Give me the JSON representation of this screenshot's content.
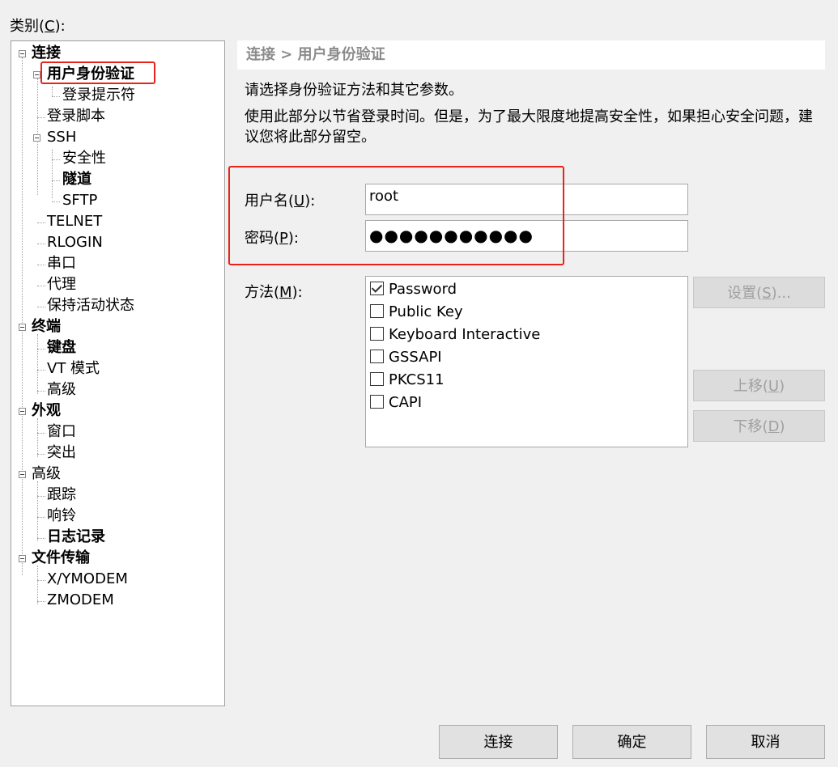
{
  "category": {
    "label": "类别",
    "hotkey": "C"
  },
  "tree": [
    {
      "label": "连接",
      "bold": true
    },
    {
      "label": "用户身份验证",
      "bold": true
    },
    {
      "label": "登录提示符",
      "bold": false
    },
    {
      "label": "登录脚本",
      "bold": false
    },
    {
      "label": "SSH",
      "bold": false
    },
    {
      "label": "安全性",
      "bold": false
    },
    {
      "label": "隧道",
      "bold": true
    },
    {
      "label": "SFTP",
      "bold": false
    },
    {
      "label": "TELNET",
      "bold": false
    },
    {
      "label": "RLOGIN",
      "bold": false
    },
    {
      "label": "串口",
      "bold": false
    },
    {
      "label": "代理",
      "bold": false
    },
    {
      "label": "保持活动状态",
      "bold": false
    },
    {
      "label": "终端",
      "bold": true
    },
    {
      "label": "键盘",
      "bold": true
    },
    {
      "label": "VT 模式",
      "bold": false
    },
    {
      "label": "高级",
      "bold": false
    },
    {
      "label": "外观",
      "bold": true
    },
    {
      "label": "窗口",
      "bold": false
    },
    {
      "label": "突出",
      "bold": false
    },
    {
      "label": "高级",
      "bold": false
    },
    {
      "label": "跟踪",
      "bold": false
    },
    {
      "label": "响铃",
      "bold": false
    },
    {
      "label": "日志记录",
      "bold": true
    },
    {
      "label": "文件传输",
      "bold": true
    },
    {
      "label": "X/YMODEM",
      "bold": false
    },
    {
      "label": "ZMODEM",
      "bold": false
    }
  ],
  "breadcrumb": "连接 > 用户身份验证",
  "description1": "请选择身份验证方法和其它参数。",
  "description2": "使用此部分以节省登录时间。但是，为了最大限度地提高安全性，如果担心安全问题，建议您将此部分留空。",
  "username": {
    "label": "用户名",
    "hotkey": "U",
    "value": "root"
  },
  "password": {
    "label": "密码",
    "hotkey": "P",
    "value": "●●●●●●●●●●●"
  },
  "method": {
    "label": "方法",
    "hotkey": "M",
    "items": [
      {
        "label": "Password",
        "checked": true
      },
      {
        "label": "Public Key",
        "checked": false
      },
      {
        "label": "Keyboard Interactive",
        "checked": false
      },
      {
        "label": "GSSAPI",
        "checked": false
      },
      {
        "label": "PKCS11",
        "checked": false
      },
      {
        "label": "CAPI",
        "checked": false
      }
    ]
  },
  "buttons": {
    "settings": {
      "label": "设置",
      "hotkey": "S",
      "suffix": "..."
    },
    "up": {
      "label": "上移",
      "hotkey": "U"
    },
    "down": {
      "label": "下移",
      "hotkey": "D"
    },
    "connect": "连接",
    "ok": "确定",
    "cancel": "取消"
  },
  "colors": {
    "highlight": "#e8231a",
    "background": "#f0f0f0"
  }
}
